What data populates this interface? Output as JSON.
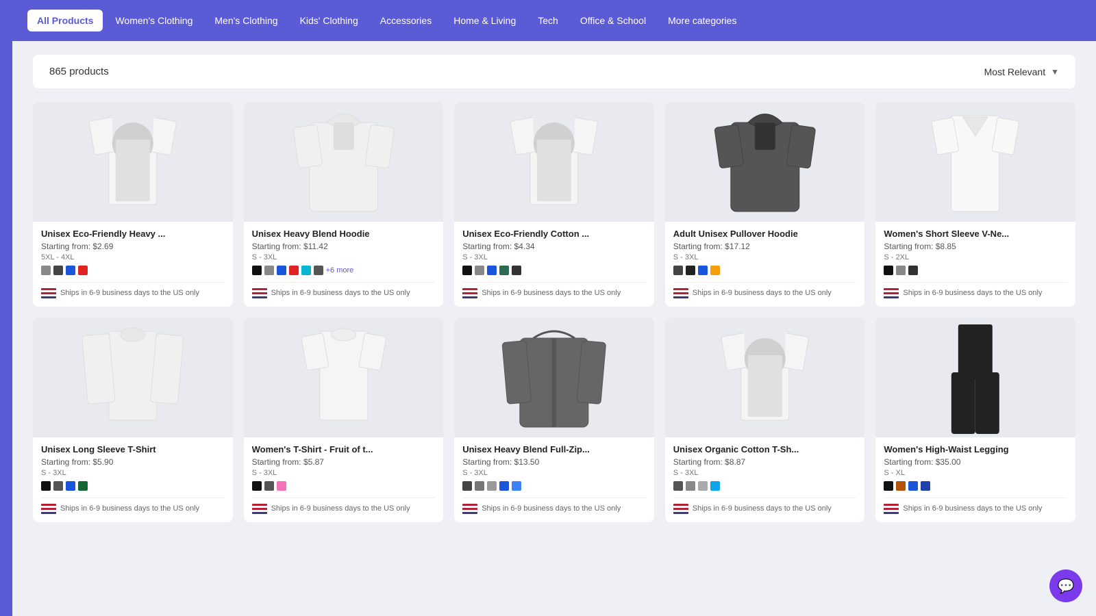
{
  "nav": {
    "tabs": [
      {
        "label": "All Products",
        "active": true
      },
      {
        "label": "Women's Clothing",
        "active": false
      },
      {
        "label": "Men's Clothing",
        "active": false
      },
      {
        "label": "Kids' Clothing",
        "active": false
      },
      {
        "label": "Accessories",
        "active": false
      },
      {
        "label": "Home & Living",
        "active": false
      },
      {
        "label": "Tech",
        "active": false
      },
      {
        "label": "Office & School",
        "active": false
      },
      {
        "label": "More categories",
        "active": false
      }
    ]
  },
  "filter": {
    "product_count": "865 products",
    "sort_label": "Most Relevant"
  },
  "products": [
    {
      "title": "Unisex Eco-Friendly Heavy ...",
      "price": "Starting from: $2.69",
      "sizes": "5XL - 4XL",
      "colors": [
        "#888",
        "#444",
        "#1a56db",
        "#e02424"
      ],
      "extra_colors": null,
      "shipping": "Ships in 6-9 business days to the US only",
      "image_type": "tshirt_white"
    },
    {
      "title": "Unisex Heavy Blend Hoodie",
      "price": "Starting from: $11.42",
      "sizes": "S - 3XL",
      "colors": [
        "#111",
        "#888",
        "#1a56db",
        "#e02424",
        "#06b6d4",
        "#555"
      ],
      "extra_colors": "+6 more",
      "shipping": "Ships in 6-9 business days to the US only",
      "image_type": "hoodie_white"
    },
    {
      "title": "Unisex Eco-Friendly Cotton ...",
      "price": "Starting from: $4.34",
      "sizes": "S - 3XL",
      "colors": [
        "#111",
        "#888",
        "#1a56db",
        "#2d6a4f",
        "#333"
      ],
      "extra_colors": null,
      "shipping": "Ships in 6-9 business days to the US only",
      "image_type": "tshirt_white"
    },
    {
      "title": "Adult Unisex Pullover Hoodie",
      "price": "Starting from: $17.12",
      "sizes": "S - 3XL",
      "colors": [
        "#444",
        "#222",
        "#1a56db",
        "#f59e0b"
      ],
      "extra_colors": null,
      "shipping": "Ships in 6-9 business days to the US only",
      "image_type": "hoodie_dark"
    },
    {
      "title": "Women's Short Sleeve V-Ne...",
      "price": "Starting from: $8.85",
      "sizes": "S - 2XL",
      "colors": [
        "#111",
        "#888",
        "#333"
      ],
      "extra_colors": null,
      "shipping": "Ships in 6-9 business days to the US only",
      "image_type": "vneck_white"
    },
    {
      "title": "Unisex Long Sleeve T-Shirt",
      "price": "Starting from: $5.90",
      "sizes": "S - 3XL",
      "colors": [
        "#111",
        "#555",
        "#1a56db",
        "#166534"
      ],
      "extra_colors": null,
      "shipping": "Ships in 6-9 business days to the US only",
      "image_type": "longsleeve_white"
    },
    {
      "title": "Women's T-Shirt - Fruit of t...",
      "price": "Starting from: $5.87",
      "sizes": "S - 3XL",
      "colors": [
        "#111",
        "#555",
        "#f472b6"
      ],
      "extra_colors": null,
      "shipping": "Ships in 6-9 business days to the US only",
      "image_type": "tshirt_white_women"
    },
    {
      "title": "Unisex Heavy Blend Full-Zip...",
      "price": "Starting from: $13.50",
      "sizes": "S - 3XL",
      "colors": [
        "#444",
        "#777",
        "#999",
        "#1a56db",
        "#3b82f6"
      ],
      "extra_colors": null,
      "shipping": "Ships in 6-9 business days to the US only",
      "image_type": "zip_hoodie_dark"
    },
    {
      "title": "Unisex Organic Cotton T-Sh...",
      "price": "Starting from: $8.87",
      "sizes": "S - 3XL",
      "colors": [
        "#555",
        "#888",
        "#aaa",
        "#0ea5e9"
      ],
      "extra_colors": null,
      "shipping": "Ships in 6-9 business days to the US only",
      "image_type": "tshirt_white"
    },
    {
      "title": "Women's High-Waist Legging",
      "price": "Starting from: $35.00",
      "sizes": "S - XL",
      "colors": [
        "#111",
        "#b45309",
        "#1a56db",
        "#1e40af"
      ],
      "extra_colors": null,
      "shipping": "Ships in 6-9 business days to the US only",
      "image_type": "leggings_black"
    }
  ]
}
